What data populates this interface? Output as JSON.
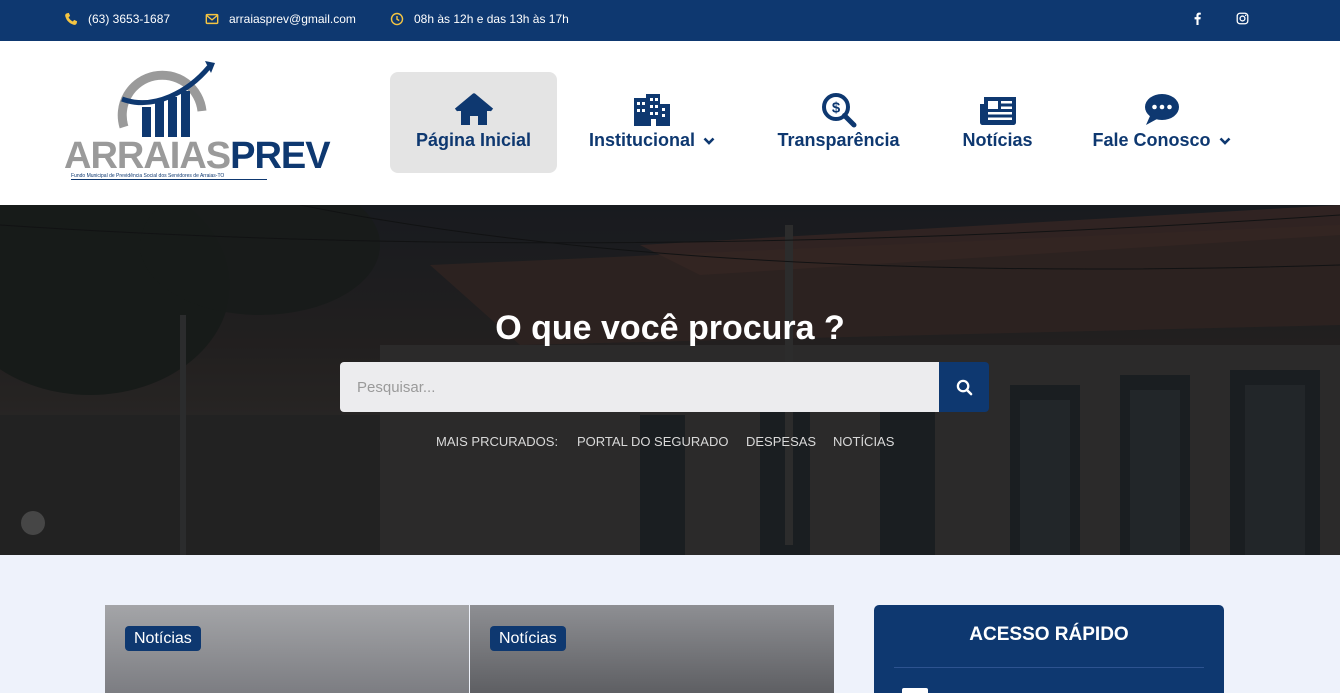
{
  "topbar": {
    "phone": "(63) 3653-1687",
    "email": "arraiasprev@gmail.com",
    "hours": "08h às 12h e das 13h às 17h",
    "phone_icon": "phone-icon",
    "email_icon": "envelope-icon",
    "hours_icon": "clock-icon",
    "social": [
      "facebook-icon",
      "instagram-icon"
    ]
  },
  "logo": {
    "part1": "ARRAIAS",
    "part2": "PREV",
    "subtitle": "Fundo Municipal de Previdência Social dos Servidores de Arraias-TO"
  },
  "nav": {
    "items": [
      {
        "label": "Página Inicial",
        "icon": "home-icon",
        "active": true,
        "dropdown": false
      },
      {
        "label": "Institucional",
        "icon": "building-icon",
        "active": false,
        "dropdown": true
      },
      {
        "label": "Transparência",
        "icon": "search-dollar-icon",
        "active": false,
        "dropdown": false
      },
      {
        "label": "Notícias",
        "icon": "newspaper-icon",
        "active": false,
        "dropdown": false
      },
      {
        "label": "Fale Conosco",
        "icon": "chat-icon",
        "active": false,
        "dropdown": true
      }
    ]
  },
  "hero": {
    "title": "O que você procura ?",
    "search_placeholder": "Pesquisar...",
    "popular_label": "MAIS PRCURADOS:",
    "popular_links": [
      "PORTAL DO SEGURADO",
      "DESPESAS",
      "NOTÍCIAS"
    ]
  },
  "cards": [
    {
      "badge": "Notícias"
    },
    {
      "badge": "Notícias"
    }
  ],
  "quick_access": {
    "title": "ACESSO RÁPIDO"
  },
  "colors": {
    "primary": "#0e3870",
    "accent_icon": "#f5c542",
    "active_nav_bg": "#e4e4e4",
    "page_bg": "#eef2fb"
  }
}
